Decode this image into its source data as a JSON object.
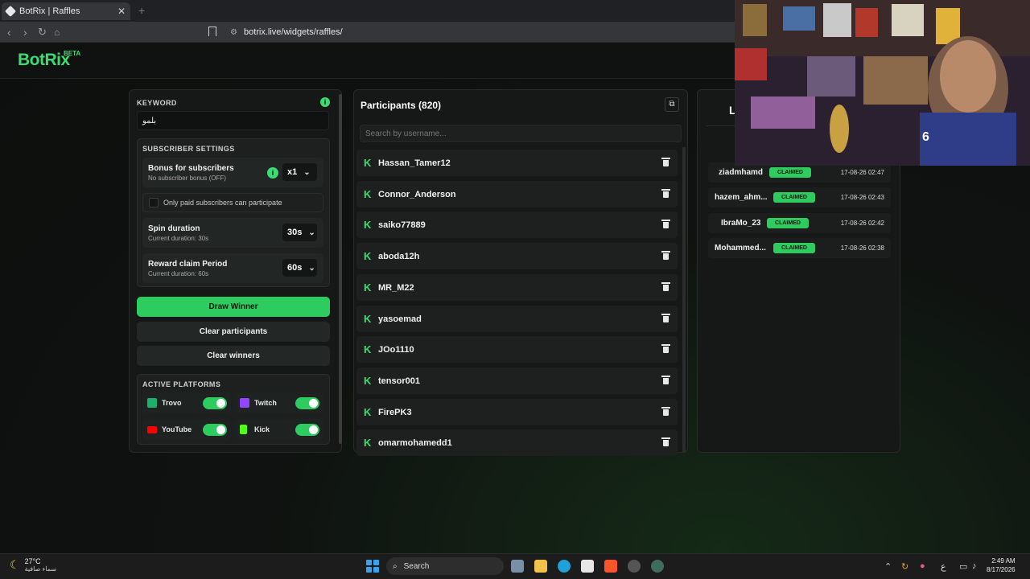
{
  "browser": {
    "tab_title": "BotRix | Raffles",
    "new_tab": "+",
    "url": "botrix.live/widgets/raffles/"
  },
  "header": {
    "logo": "BotRix",
    "beta": "BETA"
  },
  "settings": {
    "keyword_label": "KEYWORD",
    "keyword_value": "بلمو",
    "subscriber_settings_label": "SUBSCRIBER SETTINGS",
    "bonus_title": "Bonus for subscribers",
    "bonus_sub": "No subscriber bonus (OFF)",
    "bonus_value": "x1",
    "paid_only_label": "Only paid subscribers can participate",
    "spin_title": "Spin duration",
    "spin_sub": "Current duration: 30s",
    "spin_value": "30s",
    "claim_title": "Reward claim Period",
    "claim_sub": "Current duration: 60s",
    "claim_value": "60s",
    "draw_button": "Draw Winner",
    "clear_participants_button": "Clear participants",
    "clear_winners_button": "Clear winners",
    "active_platforms_label": "ACTIVE PLATFORMS",
    "platforms": [
      {
        "name": "Trovo",
        "color": "#1cb06c",
        "enabled": true
      },
      {
        "name": "Twitch",
        "color": "#9146ff",
        "enabled": true
      },
      {
        "name": "YouTube",
        "color": "#ff0000",
        "enabled": true
      },
      {
        "name": "Kick",
        "color": "#53fc18",
        "enabled": true
      }
    ]
  },
  "participants": {
    "title": "Participants (820)",
    "search_placeholder": "Search by username...",
    "list": [
      "Hassan_Tamer12",
      "Connor_Anderson",
      "saiko77889",
      "aboda12h",
      "MR_M22",
      "yasoemad",
      "JOo1110",
      "tensor001",
      "FirePK3",
      "omarmohamedd1"
    ]
  },
  "winners": {
    "heading": "L",
    "list": [
      {
        "name": "ziadmhamd",
        "status": "CLAIMED",
        "time": "17-08-26 02:47"
      },
      {
        "name": "hazem_ahm...",
        "status": "CLAIMED",
        "time": "17-08-26 02:43"
      },
      {
        "name": "IbraMo_23",
        "status": "CLAIMED",
        "time": "17-08-26 02:42"
      },
      {
        "name": "Mohammed...",
        "status": "CLAIMED",
        "time": "17-08-26 02:38"
      }
    ]
  },
  "taskbar": {
    "temp": "27°C",
    "weather_desc": "سماء صافية",
    "search_label": "Search",
    "lang": "ع",
    "time": "2:49 AM",
    "date": "8/17/2026"
  },
  "colors": {
    "accent": "#2ecc5e",
    "panel": "#161817"
  }
}
